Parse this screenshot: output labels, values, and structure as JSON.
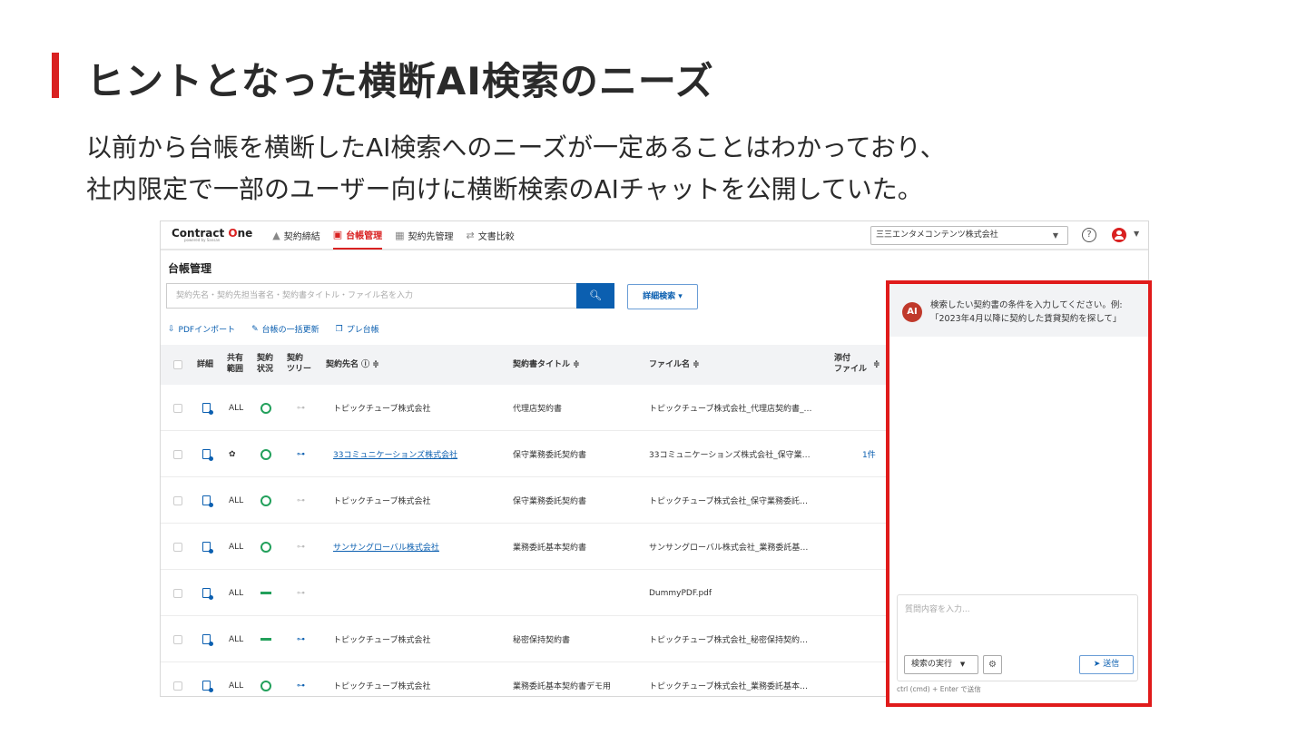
{
  "slide": {
    "title": "ヒントとなった横断AI検索のニーズ",
    "body_line1": "以前から台帳を横断したAI検索へのニーズが一定あることはわかっており、",
    "body_line2": "社内限定で一部のユーザー向けに横断検索のAIチャットを公開していた。",
    "accent_color": "#d92121"
  },
  "app": {
    "logo": {
      "main_prefix": "Contract ",
      "main_o": "O",
      "main_suffix": "ne",
      "sub": "powered by Sansan"
    },
    "nav": [
      {
        "label": "契約締結",
        "icon": "upload-icon"
      },
      {
        "label": "台帳管理",
        "icon": "gift-box-icon",
        "active": true
      },
      {
        "label": "契約先管理",
        "icon": "building-icon"
      },
      {
        "label": "文書比較",
        "icon": "swap-arrows-icon"
      }
    ],
    "company": "三三エンタメコンテンツ株式会社",
    "page_title": "台帳管理",
    "search": {
      "placeholder": "契約先名・契約先担当者名・契約書タイトル・ファイル名を入力",
      "detail_button": "詳細検索 ▾"
    },
    "actions": [
      {
        "label": "PDFインポート"
      },
      {
        "label": "台帳の一括更新"
      },
      {
        "label": "プレ台帳"
      }
    ],
    "table": {
      "headers": {
        "detail": "詳細",
        "share_1": "共有",
        "share_2": "範囲",
        "status_1": "契約",
        "status_2": "状況",
        "tree_1": "契約",
        "tree_2": "ツリー",
        "partner": "契約先名 ⓘ ≑",
        "title": "契約書タイトル ≑",
        "file": "ファイル名 ≑",
        "attach_1": "添付",
        "attach_2": "ファイル",
        "attach_sort": "≑"
      },
      "rows": [
        {
          "share": "ALL",
          "status": "ok",
          "tree": "off",
          "partner": "トピックチューブ株式会社",
          "link": false,
          "title": "代理店契約書",
          "file": "トピックチューブ株式会社_代理店契約書_…",
          "attach": ""
        },
        {
          "share": "✿",
          "status": "ok",
          "tree": "on",
          "partner": "33コミュニケーションズ株式会社",
          "link": true,
          "title": "保守業務委託契約書",
          "file": "33コミュニケーションズ株式会社_保守業…",
          "attach": "1件"
        },
        {
          "share": "ALL",
          "status": "ok",
          "tree": "off",
          "partner": "トピックチューブ株式会社",
          "link": false,
          "title": "保守業務委託契約書",
          "file": "トピックチューブ株式会社_保守業務委託…",
          "attach": ""
        },
        {
          "share": "ALL",
          "status": "ok",
          "tree": "off",
          "partner": "サンサングローバル株式会社",
          "link": true,
          "title": "業務委託基本契約書",
          "file": "サンサングローバル株式会社_業務委託基…",
          "attach": ""
        },
        {
          "share": "ALL",
          "status": "dash",
          "tree": "off",
          "partner": "",
          "link": false,
          "title": "",
          "file": "DummyPDF.pdf",
          "attach": ""
        },
        {
          "share": "ALL",
          "status": "dash",
          "tree": "on",
          "partner": "トピックチューブ株式会社",
          "link": false,
          "title": "秘密保持契約書",
          "file": "トピックチューブ株式会社_秘密保持契約…",
          "attach": ""
        },
        {
          "share": "ALL",
          "status": "ok",
          "tree": "on",
          "partner": "トピックチューブ株式会社",
          "link": false,
          "title": "業務委託基本契約書デモ用",
          "file": "トピックチューブ株式会社_業務委託基本…",
          "attach": ""
        }
      ]
    },
    "ai_chat": {
      "avatar": "AI",
      "message_1": "検索したい契約書の条件を入力してください。例:",
      "message_2": "「2023年4月以降に契約した賃貸契約を探して」",
      "input_placeholder": "質問内容を入力...",
      "run_select": "検索の実行",
      "send_label": "送信",
      "hint": "ctrl (cmd) + Enter で送信",
      "highlight_color": "#e01b1b"
    }
  }
}
